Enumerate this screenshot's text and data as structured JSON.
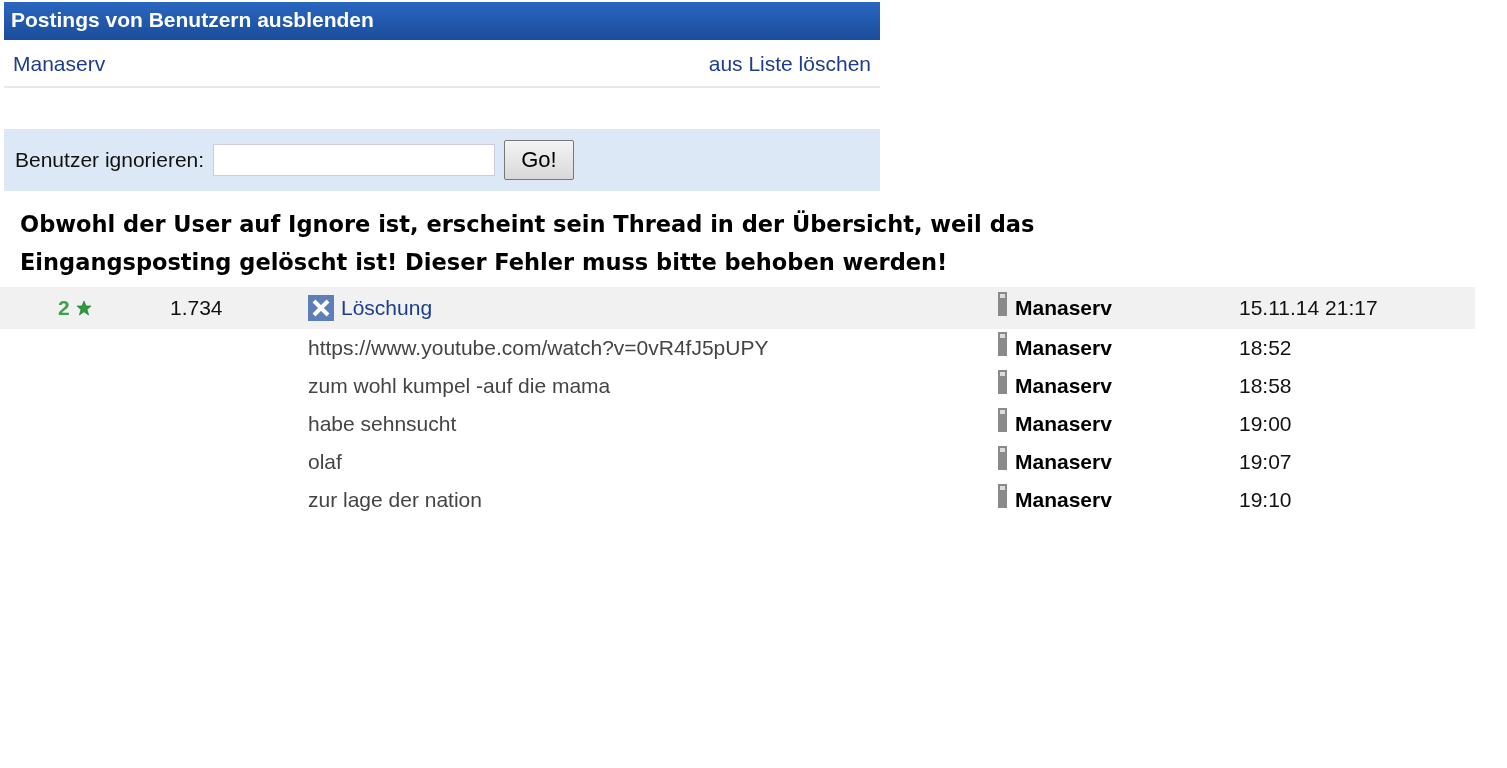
{
  "ignore_panel": {
    "title": "Postings von Benutzern ausblenden",
    "ignored_users": [
      {
        "name": "Manaserv",
        "action": "aus Liste löschen"
      }
    ],
    "form": {
      "label": "Benutzer ignorieren:",
      "button": "Go!"
    }
  },
  "annotation": "Obwohl der User auf Ignore ist, erscheint sein Thread in der Übersicht, weil das Eingangsposting gelöscht ist! Dieser Fehler muss bitte behoben werden!",
  "thread_list": [
    {
      "kind": "thread",
      "rating": "2",
      "views": "1.734",
      "title": "Löschung",
      "author": "Manaserv",
      "time": "15.11.14 21:17"
    },
    {
      "kind": "reply",
      "title": "https://www.youtube.com/watch?v=0vR4fJ5pUPY",
      "author": "Manaserv",
      "time": "18:52"
    },
    {
      "kind": "reply",
      "title": "zum wohl kumpel -auf die mama",
      "author": "Manaserv",
      "time": "18:58"
    },
    {
      "kind": "reply",
      "title": "habe sehnsucht",
      "author": "Manaserv",
      "time": "19:00"
    },
    {
      "kind": "reply",
      "title": "olaf",
      "author": "Manaserv",
      "time": "19:07"
    },
    {
      "kind": "reply",
      "title": "zur lage der nation",
      "author": "Manaserv",
      "time": "19:10"
    }
  ]
}
